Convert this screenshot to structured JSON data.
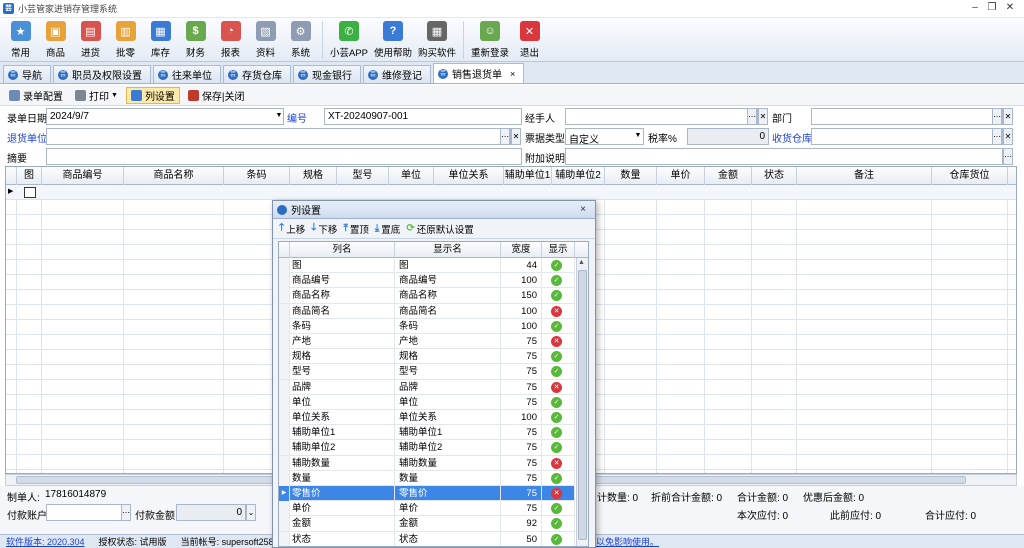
{
  "app": {
    "title": "小芸管家进销存管理系统"
  },
  "toolbar": {
    "buttons": [
      {
        "label": "常用",
        "color": "#4a90d9"
      },
      {
        "label": "商品",
        "color": "#e8a23a"
      },
      {
        "label": "进货",
        "color": "#d9534f"
      },
      {
        "label": "批零",
        "color": "#e8a23a"
      },
      {
        "label": "库存",
        "color": "#3a7bd5"
      },
      {
        "label": "财务",
        "color": "#6aa84f"
      },
      {
        "label": "报表",
        "color": "#d9534f"
      },
      {
        "label": "资料",
        "color": "#8e9db3"
      },
      {
        "label": "系统",
        "color": "#8e9db3"
      },
      {
        "label": "小芸APP",
        "color": "#3cb043"
      },
      {
        "label": "使用帮助",
        "color": "#3a7bd5"
      },
      {
        "label": "购买软件",
        "color": "#666666"
      },
      {
        "label": "重新登录",
        "color": "#6aa84f"
      },
      {
        "label": "退出",
        "color": "#d9363e"
      }
    ]
  },
  "tabs": [
    {
      "label": "导航"
    },
    {
      "label": "职员及权限设置"
    },
    {
      "label": "往来单位"
    },
    {
      "label": "存货仓库"
    },
    {
      "label": "现金银行"
    },
    {
      "label": "维修登记"
    },
    {
      "label": "销售退货单",
      "close": "×"
    }
  ],
  "subtoolbar": {
    "config": "录单配置",
    "print": "打印",
    "columns": "列设置",
    "save": "保存|关闭"
  },
  "form": {
    "date_label": "录单日期",
    "date_value": "2024/9/7",
    "number_label": "编号",
    "number_value": "XT-20240907-001",
    "handler_label": "经手人",
    "dept_label": "部门",
    "unit_label": "退货单位",
    "ticket_label": "票据类型",
    "ticket_value": "自定义",
    "tax_label": "税率%",
    "tax_value": "0",
    "warehouse_label": "收货仓库",
    "summary_label": "摘要",
    "extra_label": "附加说明"
  },
  "grid": {
    "headers": [
      "图",
      "商品编号",
      "商品名称",
      "条码",
      "规格",
      "型号",
      "单位",
      "单位关系",
      "辅助单位1",
      "辅助单位2",
      "数量",
      "单价",
      "金额",
      "状态",
      "备注",
      "仓库货位"
    ]
  },
  "bottom": {
    "maker_label": "制单人:",
    "maker_value": "17816014879",
    "account_label": "付款账户",
    "amount_label": "付款金额",
    "amount_value": "0",
    "totals": [
      "计数量: 0",
      "折前合计金额: 0",
      "合计金额: 0",
      "优惠后金额: 0"
    ],
    "payables": [
      "本次应付: 0",
      "此前应付: 0",
      "合计应付: 0"
    ]
  },
  "status": {
    "version": "软件版本: 2020.304",
    "license": "授权状态: 试用版",
    "account": "当前帐号: supersoft258",
    "notice": "以免影响使用。"
  },
  "dialog": {
    "title": "列设置",
    "close": "×",
    "tools": [
      "上移",
      "下移",
      "置顶",
      "置底",
      "还原默认设置"
    ],
    "headers": [
      "列名",
      "显示名",
      "宽度",
      "显示"
    ],
    "rows": [
      {
        "name": "图",
        "display": "图",
        "width": "44",
        "show": true
      },
      {
        "name": "商品编号",
        "display": "商品编号",
        "width": "100",
        "show": true
      },
      {
        "name": "商品名称",
        "display": "商品名称",
        "width": "150",
        "show": true
      },
      {
        "name": "商品简名",
        "display": "商品简名",
        "width": "100",
        "show": false
      },
      {
        "name": "条码",
        "display": "条码",
        "width": "100",
        "show": true
      },
      {
        "name": "产地",
        "display": "产地",
        "width": "75",
        "show": false
      },
      {
        "name": "规格",
        "display": "规格",
        "width": "75",
        "show": true
      },
      {
        "name": "型号",
        "display": "型号",
        "width": "75",
        "show": true
      },
      {
        "name": "品牌",
        "display": "品牌",
        "width": "75",
        "show": false
      },
      {
        "name": "单位",
        "display": "单位",
        "width": "75",
        "show": true
      },
      {
        "name": "单位关系",
        "display": "单位关系",
        "width": "100",
        "show": true
      },
      {
        "name": "辅助单位1",
        "display": "辅助单位1",
        "width": "75",
        "show": true
      },
      {
        "name": "辅助单位2",
        "display": "辅助单位2",
        "width": "75",
        "show": true
      },
      {
        "name": "辅助数量",
        "display": "辅助数量",
        "width": "75",
        "show": false
      },
      {
        "name": "数量",
        "display": "数量",
        "width": "75",
        "show": true
      },
      {
        "name": "零售价",
        "display": "零售价",
        "width": "75",
        "show": false,
        "selected": true
      },
      {
        "name": "单价",
        "display": "单价",
        "width": "75",
        "show": true
      },
      {
        "name": "金额",
        "display": "金额",
        "width": "92",
        "show": true
      },
      {
        "name": "状态",
        "display": "状态",
        "width": "50",
        "show": true
      }
    ]
  }
}
